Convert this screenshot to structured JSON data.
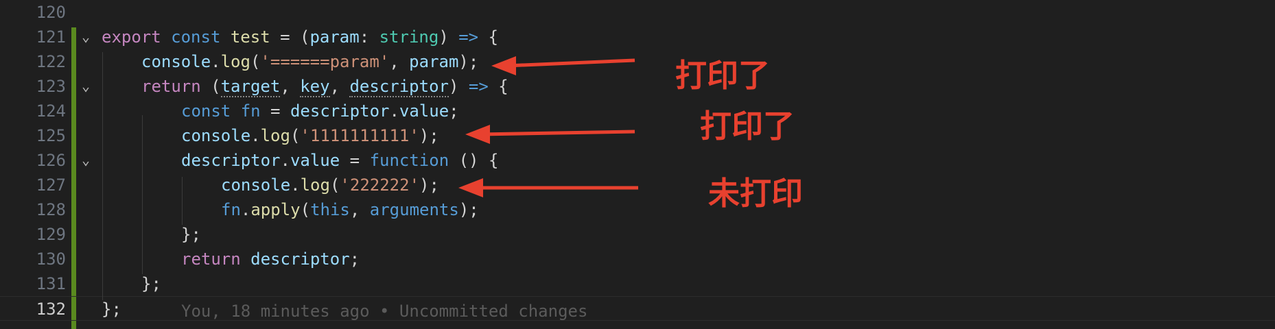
{
  "editor": {
    "lines": [
      {
        "number": "120",
        "fold": "",
        "tokens": []
      },
      {
        "number": "121",
        "fold": "⌄",
        "tokens": [
          {
            "t": "export",
            "c": "kw"
          },
          {
            "t": " ",
            "c": "pun"
          },
          {
            "t": "const",
            "c": "st"
          },
          {
            "t": " ",
            "c": "pun"
          },
          {
            "t": "test",
            "c": "fnm"
          },
          {
            "t": " = (",
            "c": "pun"
          },
          {
            "t": "param",
            "c": "var"
          },
          {
            "t": ": ",
            "c": "pun"
          },
          {
            "t": "string",
            "c": "typ"
          },
          {
            "t": ") ",
            "c": "pun"
          },
          {
            "t": "=>",
            "c": "st"
          },
          {
            "t": " {",
            "c": "pun"
          }
        ]
      },
      {
        "number": "122",
        "fold": "",
        "tokens": [
          {
            "t": "console",
            "c": "var"
          },
          {
            "t": ".",
            "c": "pun"
          },
          {
            "t": "log",
            "c": "fnm"
          },
          {
            "t": "(",
            "c": "pun"
          },
          {
            "t": "'======param'",
            "c": "str"
          },
          {
            "t": ", ",
            "c": "pun"
          },
          {
            "t": "param",
            "c": "var"
          },
          {
            "t": ");",
            "c": "pun"
          }
        ]
      },
      {
        "number": "123",
        "fold": "⌄",
        "tokens": [
          {
            "t": "return",
            "c": "kw"
          },
          {
            "t": " (",
            "c": "pun"
          },
          {
            "t": "target",
            "c": "var",
            "u": true
          },
          {
            "t": ", ",
            "c": "pun"
          },
          {
            "t": "key",
            "c": "var",
            "u": true
          },
          {
            "t": ", ",
            "c": "pun"
          },
          {
            "t": "descriptor",
            "c": "var",
            "u": true
          },
          {
            "t": ") ",
            "c": "pun"
          },
          {
            "t": "=>",
            "c": "st"
          },
          {
            "t": " {",
            "c": "pun"
          }
        ]
      },
      {
        "number": "124",
        "fold": "",
        "tokens": [
          {
            "t": "const",
            "c": "st"
          },
          {
            "t": " ",
            "c": "pun"
          },
          {
            "t": "fn",
            "c": "st"
          },
          {
            "t": " = ",
            "c": "pun"
          },
          {
            "t": "descriptor",
            "c": "var"
          },
          {
            "t": ".",
            "c": "pun"
          },
          {
            "t": "value",
            "c": "var"
          },
          {
            "t": ";",
            "c": "pun"
          }
        ]
      },
      {
        "number": "125",
        "fold": "",
        "tokens": [
          {
            "t": "console",
            "c": "var"
          },
          {
            "t": ".",
            "c": "pun"
          },
          {
            "t": "log",
            "c": "fnm"
          },
          {
            "t": "(",
            "c": "pun"
          },
          {
            "t": "'1111111111'",
            "c": "str"
          },
          {
            "t": ");",
            "c": "pun"
          }
        ]
      },
      {
        "number": "126",
        "fold": "⌄",
        "tokens": [
          {
            "t": "descriptor",
            "c": "var"
          },
          {
            "t": ".",
            "c": "pun"
          },
          {
            "t": "value",
            "c": "var"
          },
          {
            "t": " = ",
            "c": "pun"
          },
          {
            "t": "function",
            "c": "st"
          },
          {
            "t": " () {",
            "c": "pun"
          }
        ]
      },
      {
        "number": "127",
        "fold": "",
        "tokens": [
          {
            "t": "console",
            "c": "var"
          },
          {
            "t": ".",
            "c": "pun"
          },
          {
            "t": "log",
            "c": "fnm"
          },
          {
            "t": "(",
            "c": "pun"
          },
          {
            "t": "'222222'",
            "c": "str"
          },
          {
            "t": ");",
            "c": "pun"
          }
        ]
      },
      {
        "number": "128",
        "fold": "",
        "tokens": [
          {
            "t": "fn",
            "c": "st"
          },
          {
            "t": ".",
            "c": "pun"
          },
          {
            "t": "apply",
            "c": "fnm"
          },
          {
            "t": "(",
            "c": "pun"
          },
          {
            "t": "this",
            "c": "st"
          },
          {
            "t": ", ",
            "c": "pun"
          },
          {
            "t": "arguments",
            "c": "st"
          },
          {
            "t": ");",
            "c": "pun"
          }
        ]
      },
      {
        "number": "129",
        "fold": "",
        "tokens": [
          {
            "t": "};",
            "c": "pun"
          }
        ]
      },
      {
        "number": "130",
        "fold": "",
        "tokens": [
          {
            "t": "return",
            "c": "kw"
          },
          {
            "t": " ",
            "c": "pun"
          },
          {
            "t": "descriptor",
            "c": "var"
          },
          {
            "t": ";",
            "c": "pun"
          }
        ]
      },
      {
        "number": "131",
        "fold": "",
        "tokens": [
          {
            "t": "};",
            "c": "pun"
          }
        ]
      },
      {
        "number": "132",
        "fold": "",
        "tokens": [
          {
            "t": "};",
            "c": "pun"
          }
        ]
      }
    ],
    "blame": "You, 18 minutes ago • Uncommitted changes"
  },
  "annotations": {
    "note_1": "打印了",
    "note_2": "打印了",
    "note_3": "未打印",
    "color": "#e8412f"
  },
  "colors": {
    "background": "#1f1f1f",
    "git_modified_bar": "#5a8a1f"
  }
}
